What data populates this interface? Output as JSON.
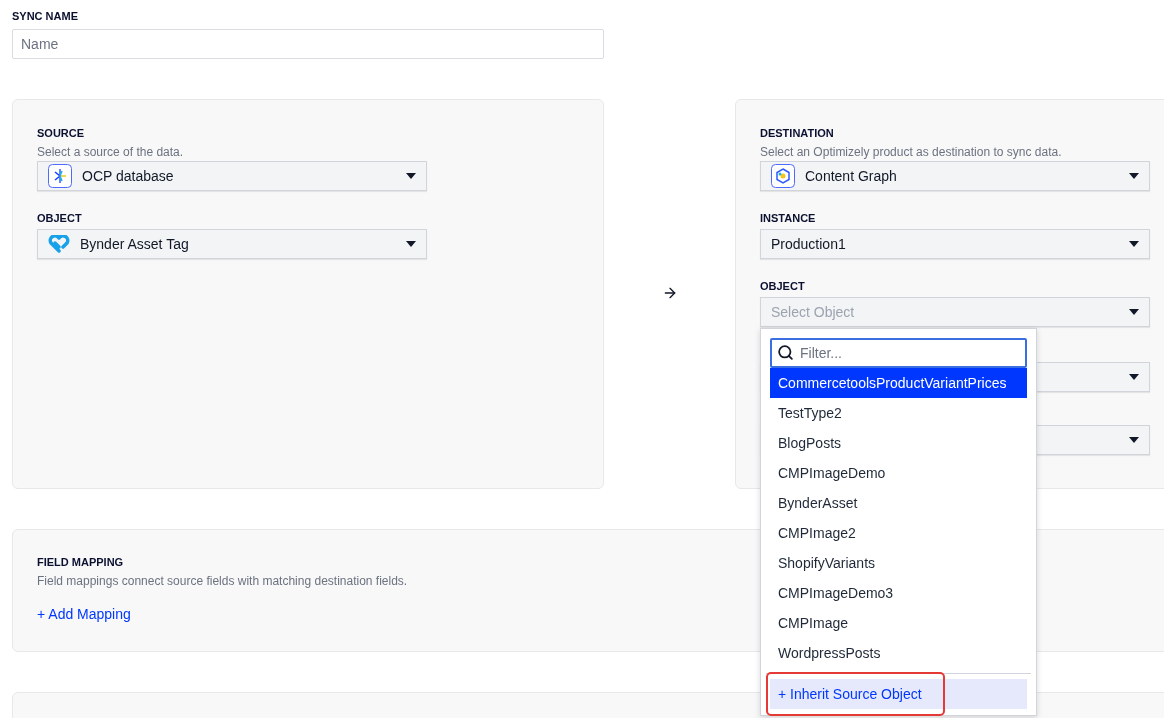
{
  "sync_name": {
    "label": "SYNC NAME",
    "placeholder": "Name"
  },
  "source": {
    "label": "SOURCE",
    "hint": "Select a source of the data.",
    "select": {
      "value": "OCP database"
    },
    "object": {
      "label": "OBJECT",
      "value": "Bynder Asset Tag"
    }
  },
  "destination": {
    "label": "DESTINATION",
    "hint": "Select an Optimizely product as destination to sync data.",
    "product": {
      "value": "Content Graph"
    },
    "instance": {
      "label": "INSTANCE",
      "value": "Production1"
    },
    "object": {
      "label": "OBJECT",
      "placeholder": "Select Object",
      "expanded": true
    },
    "dropdown": {
      "filter_placeholder": "Filter...",
      "options": [
        {
          "label": "CommercetoolsProductVariantPrices",
          "selected": true
        },
        {
          "label": "TestType2",
          "selected": false
        },
        {
          "label": "BlogPosts",
          "selected": false
        },
        {
          "label": "CMPImageDemo",
          "selected": false
        },
        {
          "label": "BynderAsset",
          "selected": false
        },
        {
          "label": "CMPImage2",
          "selected": false
        },
        {
          "label": "ShopifyVariants",
          "selected": false
        },
        {
          "label": "CMPImageDemo3",
          "selected": false
        },
        {
          "label": "CMPImage",
          "selected": false
        },
        {
          "label": "WordpressPosts",
          "selected": false
        }
      ],
      "action": "+ Inherit Source Object"
    }
  },
  "field_mapping": {
    "label": "FIELD MAPPING",
    "hint": "Field mappings connect source fields with matching destination fields.",
    "add_link": "+ Add Mapping"
  }
}
